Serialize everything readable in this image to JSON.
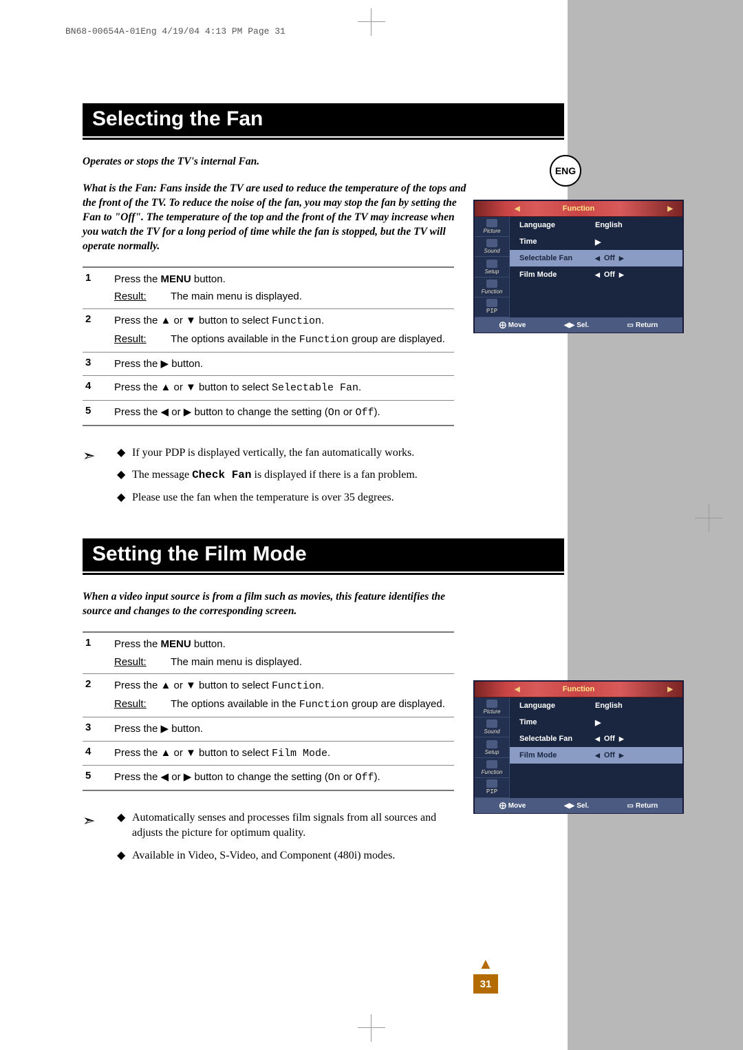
{
  "header_info": "BN68-00654A-01Eng  4/19/04  4:13 PM  Page 31",
  "lang_badge": "ENG",
  "section1": {
    "title": "Selecting the Fan",
    "intro1": "Operates or stops the TV's internal Fan.",
    "intro2": "What is the Fan: Fans inside the TV are used to reduce the temperature of the tops and the front of the TV. To reduce the noise of the fan, you may stop the fan by setting the Fan to \"Off\". The temperature of the top and the front of the TV may increase when you watch the TV for a long period of time while the fan is stopped, but the TV will operate normally.",
    "steps": [
      {
        "num": "1",
        "text_a": "Press the ",
        "bold": "MENU",
        "text_b": " button.",
        "result": "The main menu is displayed."
      },
      {
        "num": "2",
        "text_a": "Press the ▲ or ▼ button to select ",
        "mono": "Function",
        "text_b": ".",
        "result_a": "The options available in the ",
        "result_mono": "Function",
        "result_b": " group are displayed."
      },
      {
        "num": "3",
        "text_a": "Press the ▶ button.",
        "result": ""
      },
      {
        "num": "4",
        "text_a": "Press the ▲ or ▼ button to select ",
        "mono": "Selectable Fan",
        "text_b": ".",
        "result": ""
      },
      {
        "num": "5",
        "text_a": "Press the ◀ or ▶ button to change the setting (",
        "mono": "On",
        "text_mid": " or ",
        "mono2": "Off",
        "text_b": ").",
        "result": ""
      }
    ],
    "notes": [
      "If your PDP is displayed vertically, the fan automatically works.",
      {
        "a": "The message ",
        "mono": "Check Fan",
        "b": " is displayed if there is a fan problem."
      },
      "Please use the fan when the temperature is over 35 degrees."
    ]
  },
  "section2": {
    "title": "Setting the Film Mode",
    "intro": "When a video input source is from a film such as movies, this feature identifies the source and changes to the corresponding screen.",
    "steps": [
      {
        "num": "1",
        "text_a": "Press the ",
        "bold": "MENU",
        "text_b": " button.",
        "result": "The main menu is displayed."
      },
      {
        "num": "2",
        "text_a": "Press the ▲ or ▼ button to select ",
        "mono": "Function",
        "text_b": ".",
        "result_a": "The options available in the ",
        "result_mono": "Function",
        "result_b": " group are displayed."
      },
      {
        "num": "3",
        "text_a": "Press the ▶ button.",
        "result": ""
      },
      {
        "num": "4",
        "text_a": "Press the ▲ or ▼ button to select ",
        "mono": "Film Mode",
        "text_b": ".",
        "result": ""
      },
      {
        "num": "5",
        "text_a": "Press the ◀ or ▶ button to change the setting (",
        "mono": "On",
        "text_mid": " or ",
        "mono2": "Off",
        "text_b": ").",
        "result": ""
      }
    ],
    "notes": [
      "Automatically senses and processes film signals from all sources and adjusts the picture for optimum quality.",
      "Available in Video, S-Video, and Component (480i) modes."
    ]
  },
  "osd": {
    "title": "Function",
    "sidebar": [
      "Picture",
      "Sound",
      "Setup",
      "Function",
      "PIP"
    ],
    "rows": [
      {
        "label": "Language",
        "value": "English",
        "arrows": false
      },
      {
        "label": "Time",
        "value": "▶",
        "arrows": false
      },
      {
        "label": "Selectable Fan",
        "value": "Off",
        "arrows": true
      },
      {
        "label": "Film Mode",
        "value": "Off",
        "arrows": true
      }
    ],
    "highlight1": 2,
    "highlight2": 3,
    "footer": {
      "move": "Move",
      "sel": "Sel.",
      "ret": "Return"
    }
  },
  "page_number": "31",
  "result_label": "Result:"
}
